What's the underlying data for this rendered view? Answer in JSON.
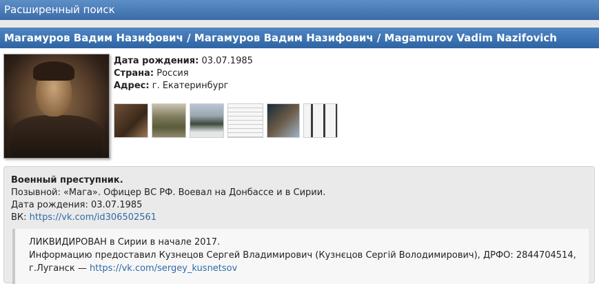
{
  "header": {
    "title": "Расширенный поиск"
  },
  "person": {
    "title": "Магамуров Вадим Назифович / Магамуров Вадим Назифович / Magamurov Vadim Nazifovich",
    "fields": [
      {
        "label": "Дата рождения:",
        "value": "03.07.1985"
      },
      {
        "label": "Страна:",
        "value": "Россия"
      },
      {
        "label": "Адрес:",
        "value": "г. Екатеринбург"
      }
    ]
  },
  "description": {
    "heading": "Военный преступник.",
    "line1": "Позывной: «Мага». Офицер ВС РФ. Воевал на Донбассе и в Сирии.",
    "line2": "Дата рождения: 03.07.1985",
    "vk_label": "ВК:",
    "vk_link": "https://vk.com/id306502561"
  },
  "note": {
    "line1": "ЛИКВИДИРОВАН в Сирии в начале 2017.",
    "line2": "Информацию предоставил Кузнецов Сергей Владимирович (Кузнєцов Сергій Володимирович), ДРФО: 2844704514,",
    "line3_prefix": "г.Луганск —",
    "link": "https://vk.com/sergey_kusnetsov"
  }
}
